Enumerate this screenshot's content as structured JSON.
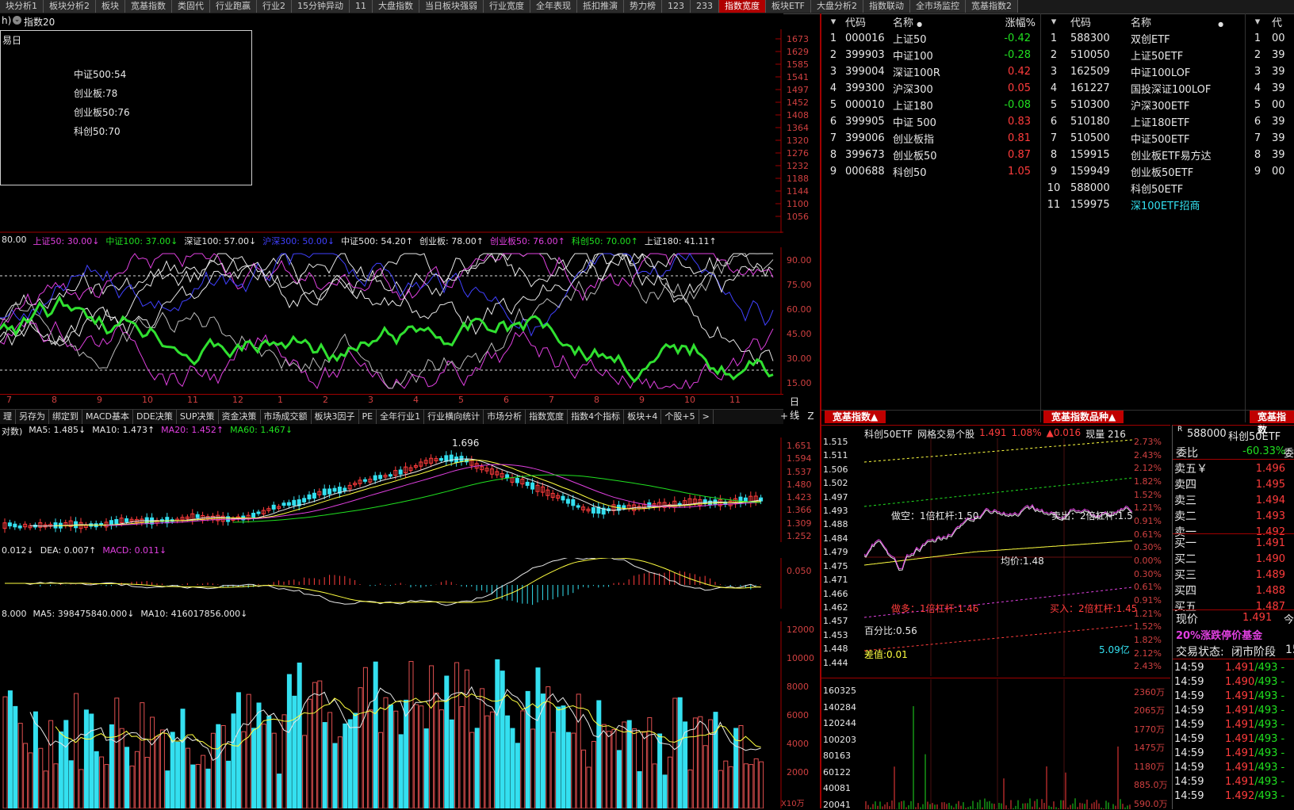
{
  "tabs": [
    "块分析1",
    "板块分析2",
    "板块",
    "宽基指数",
    "类固代",
    "行业跑赢",
    "行业2",
    "15分钟异动",
    "11",
    "大盘指数",
    "当日板块强弱",
    "行业宽度",
    "全年表现",
    "抵扣推演",
    "势力榜",
    "123",
    "233",
    "指数宽度",
    "板块ETF",
    "大盘分析2",
    "指数联动",
    "全市场监控",
    "宽基指数2"
  ],
  "active_tab": "指数宽度",
  "title_bar": {
    "prefix": "h)",
    "title": "指数20"
  },
  "popup": {
    "corner": "易日",
    "lines": [
      "中证500:54",
      "创业板:78",
      "创业板50:76",
      "科创50:70"
    ]
  },
  "top_ticks": [
    "1673",
    "1629",
    "1585",
    "1541",
    "1497",
    "1452",
    "1408",
    "1364",
    "1320",
    "1276",
    "1232",
    "1188",
    "1144",
    "1100",
    "1056"
  ],
  "breadth_legend": [
    {
      "text": "80.00",
      "color": "#e8e8e8"
    },
    {
      "text": "上证50: 30.00↓",
      "color": "#e040e0"
    },
    {
      "text": "中证100: 37.00↓",
      "color": "#20e020"
    },
    {
      "text": "深证100: 57.00↓",
      "color": "#e8e8e8"
    },
    {
      "text": "沪深300: 50.00↓",
      "color": "#4040ff"
    },
    {
      "text": "中证500: 54.20↑",
      "color": "#e8e8e8"
    },
    {
      "text": "创业板: 78.00↑",
      "color": "#e8e8e8"
    },
    {
      "text": "创业板50: 76.00↑",
      "color": "#e040e0"
    },
    {
      "text": "科创50: 70.00↑",
      "color": "#20e020"
    },
    {
      "text": "上证180: 41.11↑",
      "color": "#e8e8e8"
    }
  ],
  "breadth_ticks": [
    "90.00",
    "75.00",
    "60.00",
    "45.00",
    "30.00",
    "15.00"
  ],
  "month_labels": [
    "7",
    "8",
    "9",
    "10",
    "11",
    "12",
    "1",
    "2",
    "3",
    "4",
    "5",
    "6",
    "7",
    "8",
    "9",
    "10",
    "11"
  ],
  "period_label": "日线",
  "bottom_tabs": [
    "理",
    "另存为",
    "绑定到",
    "MACD基本",
    "DDE决策",
    "SUP决策",
    "资金决策",
    "市场成交额",
    "板块3因子",
    "PE",
    "全年行业1",
    "行业横向统计",
    "市场分析",
    "指数宽度",
    "指数4个指标",
    "板块+4",
    "个股+5",
    ">"
  ],
  "bottom_controls": [
    "+",
    "-",
    "Z"
  ],
  "ma_legend": [
    {
      "text": "对数)",
      "color": "#e8e8e8"
    },
    {
      "text": "MA5: 1.485↓",
      "color": "#e8e8e8"
    },
    {
      "text": "MA10: 1.473↑",
      "color": "#e8e8e8"
    },
    {
      "text": "MA20: 1.452↑",
      "color": "#e040e0"
    },
    {
      "text": "MA60: 1.467↓",
      "color": "#20e020"
    }
  ],
  "price_ticks": [
    "1.651",
    "1.594",
    "1.537",
    "1.480",
    "1.423",
    "1.366",
    "1.309",
    "1.252"
  ],
  "price_annotation": "1.696",
  "macd_legend": [
    {
      "text": "0.012↓",
      "color": "#e8e8e8"
    },
    {
      "text": "DEA: 0.007↑",
      "color": "#e8e8e8"
    },
    {
      "text": "MACD: 0.011↓",
      "color": "#e040e0"
    }
  ],
  "macd_ticks": [
    "0.050"
  ],
  "vol_legend": [
    {
      "text": "8.000",
      "color": "#e8e8e8"
    },
    {
      "text": "MA5: 398475840.000↓",
      "color": "#e8e8e8"
    },
    {
      "text": "MA10: 416017856.000↓",
      "color": "#e8e8e8"
    }
  ],
  "vol_ticks": [
    "12000",
    "10000",
    "8000",
    "6000",
    "4000",
    "2000"
  ],
  "vol_unit": "X10万",
  "watchlist_a": {
    "headers": [
      "代码",
      "名称",
      "涨幅%"
    ],
    "rows": [
      {
        "n": "1",
        "code": "000016",
        "name": "上证50",
        "chg": "-0.42",
        "dir": "down"
      },
      {
        "n": "2",
        "code": "399903",
        "name": "中证100",
        "chg": "-0.28",
        "dir": "down"
      },
      {
        "n": "3",
        "code": "399004",
        "name": "深证100R",
        "chg": "0.42",
        "dir": "up"
      },
      {
        "n": "4",
        "code": "399300",
        "name": "沪深300",
        "chg": "0.05",
        "dir": "up"
      },
      {
        "n": "5",
        "code": "000010",
        "name": "上证180",
        "chg": "-0.08",
        "dir": "down"
      },
      {
        "n": "6",
        "code": "399905",
        "name": "中证 500",
        "chg": "0.83",
        "dir": "up"
      },
      {
        "n": "7",
        "code": "399006",
        "name": "创业板指",
        "chg": "0.81",
        "dir": "up"
      },
      {
        "n": "8",
        "code": "399673",
        "name": "创业板50",
        "chg": "0.87",
        "dir": "up"
      },
      {
        "n": "9",
        "code": "000688",
        "name": "科创50",
        "chg": "1.05",
        "dir": "up"
      }
    ],
    "footer": "宽基指数▲"
  },
  "watchlist_b": {
    "headers": [
      "代码",
      "名称"
    ],
    "rows": [
      {
        "n": "1",
        "code": "588300",
        "name": "双创ETF"
      },
      {
        "n": "2",
        "code": "510050",
        "name": "上证50ETF"
      },
      {
        "n": "3",
        "code": "162509",
        "name": "中证100LOF"
      },
      {
        "n": "4",
        "code": "161227",
        "name": "国投深证100LOF"
      },
      {
        "n": "5",
        "code": "510300",
        "name": "沪深300ETF"
      },
      {
        "n": "6",
        "code": "510180",
        "name": "上证180ETF"
      },
      {
        "n": "7",
        "code": "510500",
        "name": "中证500ETF"
      },
      {
        "n": "8",
        "code": "159915",
        "name": "创业板ETF易方达"
      },
      {
        "n": "9",
        "code": "159949",
        "name": "创业板50ETF"
      },
      {
        "n": "10",
        "code": "588000",
        "name": "科创50ETF"
      },
      {
        "n": "11",
        "code": "159975",
        "name": "深100ETF招商"
      }
    ],
    "footer": "宽基指数品种▲"
  },
  "watchlist_c": {
    "header": "代",
    "rows": [
      {
        "n": "1",
        "code": "00"
      },
      {
        "n": "2",
        "code": "39"
      },
      {
        "n": "3",
        "code": "39"
      },
      {
        "n": "4",
        "code": "39"
      },
      {
        "n": "5",
        "code": "00"
      },
      {
        "n": "6",
        "code": "39"
      },
      {
        "n": "7",
        "code": "39"
      },
      {
        "n": "8",
        "code": "39"
      },
      {
        "n": "9",
        "code": "00"
      }
    ],
    "footer": "宽基指数"
  },
  "intraday": {
    "header": [
      "科创50ETF",
      "网格交易个股",
      "1.491",
      "1.08%",
      "▲0.016",
      "现量 216"
    ],
    "left_ticks": [
      "1.515",
      "1.511",
      "1.506",
      "1.502",
      "1.497",
      "1.493",
      "1.488",
      "1.484",
      "1.479",
      "1.475",
      "1.471",
      "1.466",
      "1.462",
      "1.457",
      "1.453",
      "1.448",
      "1.444"
    ],
    "right_ticks": [
      "2.73%",
      "2.43%",
      "2.12%",
      "1.82%",
      "1.52%",
      "1.21%",
      "0.91%",
      "0.61%",
      "0.30%",
      "0.00%",
      "0.30%",
      "0.61%",
      "0.91%",
      "1.21%",
      "1.52%",
      "1.82%",
      "2.12%",
      "2.43%"
    ],
    "annotations": {
      "short": "做空：1倍杠杆:1.50",
      "sell": "卖出：2倍杠杆:1.5",
      "avg": "均价:1.48",
      "long": "做多：1倍杠杆:1.46",
      "buy": "买入：2倍杠杆:1.45",
      "pct": "百分比:0.56",
      "diff": "差值:0.01",
      "amount": "5.09亿"
    },
    "vol_left_ticks": [
      "160325",
      "140284",
      "120244",
      "100203",
      "80163",
      "60122",
      "40081",
      "20041"
    ],
    "vol_right_ticks": [
      "2360万",
      "2065万",
      "1770万",
      "1475万",
      "1180万",
      "885.0万",
      "590.0万"
    ]
  },
  "orderbook": {
    "badge": "R",
    "code": "588000",
    "name": "科创50ETF",
    "ratio_label": "委比",
    "ratio": "-60.33%",
    "ratio_suffix": "委",
    "asks": [
      {
        "label": "卖五￥",
        "price": "1.496"
      },
      {
        "label": "卖四",
        "price": "1.495"
      },
      {
        "label": "卖三",
        "price": "1.494"
      },
      {
        "label": "卖二",
        "price": "1.493"
      },
      {
        "label": "卖一",
        "price": "1.492"
      }
    ],
    "bids": [
      {
        "label": "买一",
        "price": "1.491"
      },
      {
        "label": "买二",
        "price": "1.490"
      },
      {
        "label": "买三",
        "price": "1.489"
      },
      {
        "label": "买四",
        "price": "1.488"
      },
      {
        "label": "买五",
        "price": "1.487"
      }
    ],
    "last_label": "现价",
    "last_price": "1.491",
    "last_suffix": "今",
    "fund_note": "20%涨跌停价基金",
    "status_label": "交易状态:",
    "status": "闭市阶段",
    "status_suffix": "15",
    "trades": [
      {
        "t": "14:59",
        "p": "1.491",
        "v": "/493 -"
      },
      {
        "t": "14:59",
        "p": "1.490",
        "v": "/493 -"
      },
      {
        "t": "14:59",
        "p": "1.491",
        "v": "/493 -"
      },
      {
        "t": "14:59",
        "p": "1.491",
        "v": "/493 -"
      },
      {
        "t": "14:59",
        "p": "1.491",
        "v": "/493 -"
      },
      {
        "t": "14:59",
        "p": "1.491",
        "v": "/493 -"
      },
      {
        "t": "14:59",
        "p": "1.491",
        "v": "/493 -"
      },
      {
        "t": "14:59",
        "p": "1.491",
        "v": "/493 -"
      },
      {
        "t": "14:59",
        "p": "1.491",
        "v": "/493 -"
      },
      {
        "t": "14:59",
        "p": "1.492",
        "v": "/493 -"
      }
    ]
  }
}
